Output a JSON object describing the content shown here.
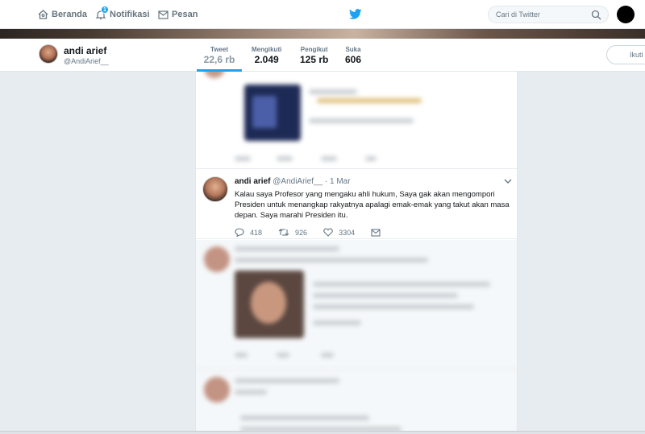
{
  "nav": {
    "home": "Beranda",
    "notifications": "Notifikasi",
    "notification_count": "1",
    "messages": "Pesan",
    "search_placeholder": "Cari di Twitter"
  },
  "profile": {
    "name": "andi arief",
    "handle": "@AndiArief__",
    "follow_button": "Ikuti",
    "stats": [
      {
        "label": "Tweet",
        "value": "22,6 rb"
      },
      {
        "label": "Mengikuti",
        "value": "2.049"
      },
      {
        "label": "Pengikut",
        "value": "125 rb"
      },
      {
        "label": "Suka",
        "value": "606"
      }
    ]
  },
  "tweet": {
    "name": "andi arief",
    "handle": "@AndiArief__",
    "date": "· 1 Mar",
    "text": "Kalau saya Profesor yang mengaku ahli hukum, Saya gak akan mengompori Presiden untuk menangkap rakyatnya apalagi emak-emak yang takut akan masa depan. Saya marahi Presiden itu.",
    "replies": "418",
    "retweets": "926",
    "likes": "3304"
  },
  "colors": {
    "accent": "#1da1f2",
    "background": "#e6ecf0"
  }
}
